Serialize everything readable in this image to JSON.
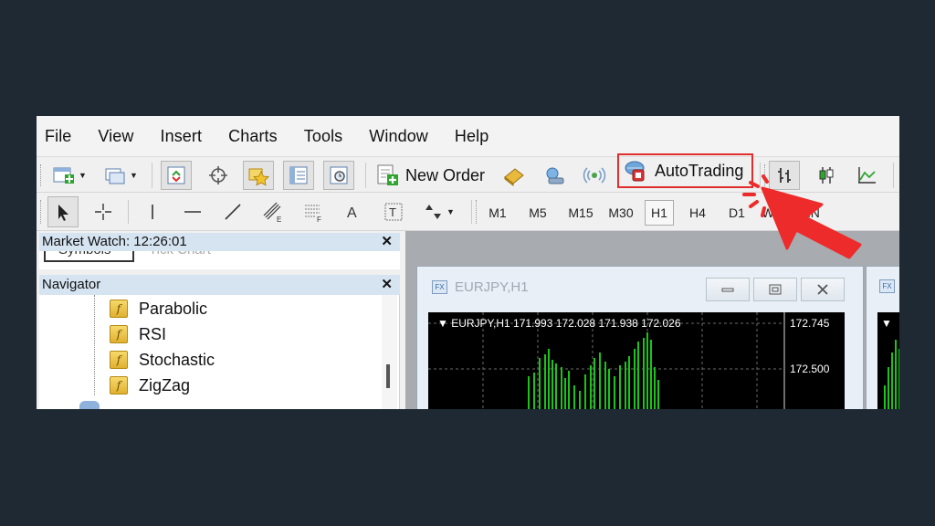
{
  "menu": [
    "File",
    "View",
    "Insert",
    "Charts",
    "Tools",
    "Window",
    "Help"
  ],
  "toolbar": {
    "new_order_label": "New Order",
    "autotrading_label": "AutoTrading"
  },
  "timeframes": [
    "M1",
    "M5",
    "M15",
    "M30",
    "H1",
    "H4",
    "D1",
    "W1",
    "MN"
  ],
  "active_timeframe": "H1",
  "market_watch": {
    "title": "Market Watch: 12:26:01",
    "tabs": [
      "Symbols",
      "Tick Chart"
    ]
  },
  "navigator": {
    "title": "Navigator",
    "items": [
      "Parabolic",
      "RSI",
      "Stochastic",
      "ZigZag"
    ]
  },
  "chart_window": {
    "title": "EURJPY,H1",
    "info": "EURJPY,H1  171.993 172.028 171.938 172.026",
    "price_labels": [
      "172.745",
      "172.500"
    ]
  },
  "colors": {
    "background": "#1e2933",
    "highlight_border": "#e02d2d",
    "candles": "#19c519",
    "panel_title": "#d6e4f2"
  }
}
